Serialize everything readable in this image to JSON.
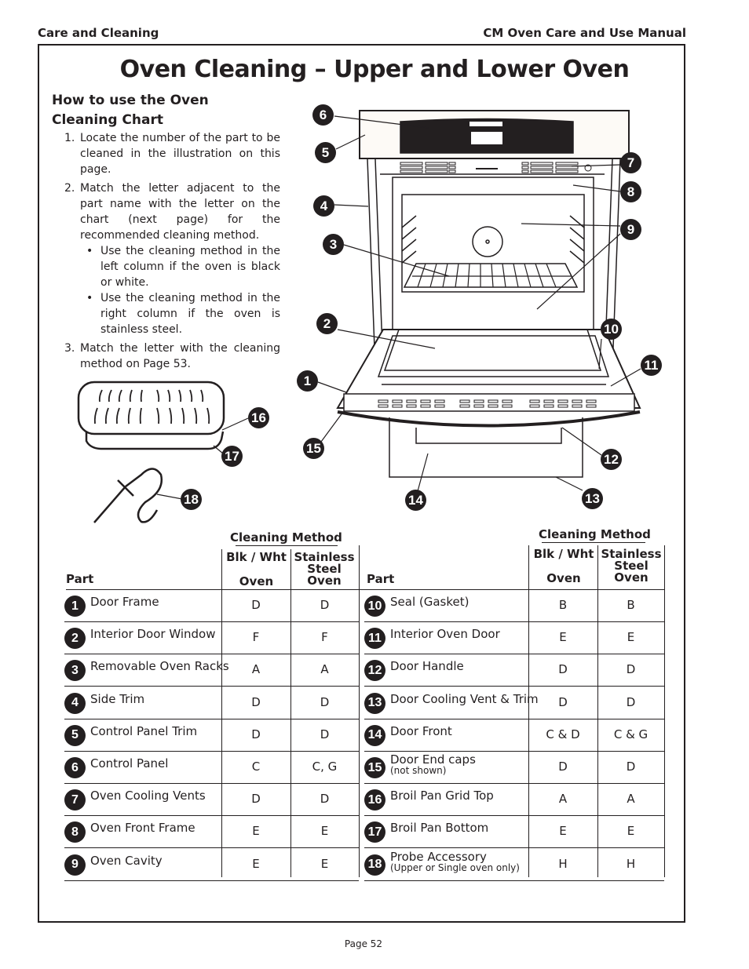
{
  "header": {
    "section": "Care and Cleaning",
    "manual": "CM Oven Care and Use Manual"
  },
  "title": "Oven Cleaning – Upper and Lower Oven",
  "howto": {
    "heading_line1": "How to use the Oven",
    "heading_line2": "Cleaning Chart",
    "steps": [
      {
        "num": "1.",
        "text": "Locate the number of the part to be cleaned in the illustration on this page."
      },
      {
        "num": "2.",
        "text": "Match the letter adjacent to the part name with the letter on the chart (next page) for the recommended cleaning method."
      },
      {
        "num": "3.",
        "text": "Match the letter with the cleaning method on Page 53."
      }
    ],
    "bullets": [
      {
        "symbol": "•",
        "text": "Use the cleaning method in the left column if the oven is black or white."
      },
      {
        "symbol": "•",
        "text": "Use the cleaning method in the right column if the oven is stainless steel."
      }
    ]
  },
  "illustration": {
    "callouts": [
      "1",
      "2",
      "3",
      "4",
      "5",
      "6",
      "7",
      "8",
      "9",
      "10",
      "11",
      "12",
      "13",
      "14",
      "15",
      "16",
      "17",
      "18"
    ]
  },
  "table": {
    "group_label": "Cleaning Method",
    "col_part": "Part",
    "col_blk_line1": "Blk / Wht",
    "col_blk_line2": "Oven",
    "col_ss_line1": "Stainless",
    "col_ss_line2": "Steel",
    "col_ss_line3": "Oven",
    "left_rows": [
      {
        "num": "1",
        "part": "Door Frame",
        "note": "",
        "blk": "D",
        "ss": "D"
      },
      {
        "num": "2",
        "part": "Interior Door Window",
        "note": "",
        "blk": "F",
        "ss": "F"
      },
      {
        "num": "3",
        "part": "Removable Oven Racks",
        "note": "",
        "blk": "A",
        "ss": "A"
      },
      {
        "num": "4",
        "part": "Side Trim",
        "note": "",
        "blk": "D",
        "ss": "D"
      },
      {
        "num": "5",
        "part": "Control Panel Trim",
        "note": "",
        "blk": "D",
        "ss": "D"
      },
      {
        "num": "6",
        "part": "Control Panel",
        "note": "",
        "blk": "C",
        "ss": "C, G"
      },
      {
        "num": "7",
        "part": "Oven Cooling Vents",
        "note": "",
        "blk": "D",
        "ss": "D"
      },
      {
        "num": "8",
        "part": "Oven Front Frame",
        "note": "",
        "blk": "E",
        "ss": "E"
      },
      {
        "num": "9",
        "part": "Oven Cavity",
        "note": "",
        "blk": "E",
        "ss": "E"
      }
    ],
    "right_rows": [
      {
        "num": "10",
        "part": "Seal (Gasket)",
        "note": "",
        "blk": "B",
        "ss": "B"
      },
      {
        "num": "11",
        "part": "Interior Oven Door",
        "note": "",
        "blk": "E",
        "ss": "E"
      },
      {
        "num": "12",
        "part": "Door Handle",
        "note": "",
        "blk": "D",
        "ss": "D"
      },
      {
        "num": "13",
        "part": "Door Cooling Vent & Trim",
        "note": "",
        "blk": "D",
        "ss": "D"
      },
      {
        "num": "14",
        "part": "Door Front",
        "note": "",
        "blk": "C & D",
        "ss": "C & G"
      },
      {
        "num": "15",
        "part": "Door End caps",
        "note": "(not shown)",
        "blk": "D",
        "ss": "D"
      },
      {
        "num": "16",
        "part": "Broil Pan Grid Top",
        "note": "",
        "blk": "A",
        "ss": "A"
      },
      {
        "num": "17",
        "part": "Broil Pan Bottom",
        "note": "",
        "blk": "E",
        "ss": "E"
      },
      {
        "num": "18",
        "part": "Probe Accessory",
        "note": "(Upper or Single oven only)",
        "blk": "H",
        "ss": "H"
      }
    ]
  },
  "footer": {
    "page": "Page 52"
  }
}
